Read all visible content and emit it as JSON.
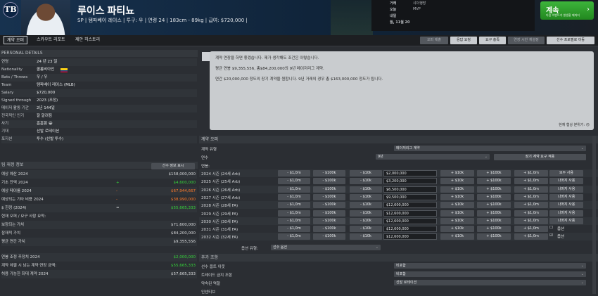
{
  "header": {
    "logo": "TB",
    "player_name": "루이스 파티뇨",
    "player_info": "SP | 탬파베이 레이스 | 투구: 우 | 연령 24 | 183cm - 89kg | 급여: $720,000 |",
    "roster": [
      {
        "k": "거래",
        "v": "샤이행방"
      },
      {
        "k": "오늘",
        "v": "MVP"
      },
      {
        "k": "내일",
        "v": ""
      },
      {
        "k": "월, 11월 20",
        "v": ""
      }
    ],
    "continue_label": "계속",
    "continue_sub": "다음 이벤트가 발생할 때까지",
    "continue_arrow": "›"
  },
  "tabs": [
    {
      "label": "계약 오퍼"
    },
    {
      "label": "스카우트 리포트"
    },
    {
      "label": "제안 히스토리"
    }
  ],
  "header_buttons": [
    {
      "label": "오퍼 제출"
    },
    {
      "label": "응답 요청"
    },
    {
      "label": "요구 충족"
    },
    {
      "label": "연장 시한 재설정"
    },
    {
      "label": "선수 프로필로 이동"
    }
  ],
  "personal": {
    "title": "PERSONAL DETAILS",
    "rows": [
      {
        "k": "연령",
        "v": "24 년 23 일"
      },
      {
        "k": "Nationality",
        "v": "콜롬비아인"
      },
      {
        "k": "Bats / Throws",
        "v": "우 / 우"
      },
      {
        "k": "Team",
        "v": "탬파베이 레이스 (MLB)"
      },
      {
        "k": "Salary",
        "v": "$720,000"
      },
      {
        "k": "Signed through",
        "v": "2023 (조정)"
      },
      {
        "k": "메이저 활동 기간",
        "v": "2년 144일"
      },
      {
        "k": "전국적인 인기",
        "v": "잘 알려짐"
      },
      {
        "k": "사기",
        "v": "흠흠함 😀"
      },
      {
        "k": "기대",
        "v": "선발 로테이션"
      },
      {
        "k": "포지션",
        "v": "투수 (선발 투수)"
      }
    ]
  },
  "team_finance": {
    "title": "팀 재정 정보",
    "button": "선수 정보 표시",
    "rows": [
      {
        "k": "예상 예산 2024",
        "op": "",
        "v": "$158,000,000",
        "c": ""
      },
      {
        "k": "기초 잔액 2024",
        "op": "+",
        "v": "$4,600,000",
        "c": "green"
      },
      {
        "k": "예상 페이롤 2024",
        "op": "-",
        "v": "$67,944,667",
        "c": "orange"
      },
      {
        "k": "예상되는 기타 비용 2024",
        "op": "-",
        "v": "$38,990,000",
        "c": "orange"
      },
      {
        "k": "$ 한정 (2024)",
        "op": "=",
        "v": "$55,665,333",
        "c": "green"
      }
    ]
  },
  "current_offer": {
    "title": "현재 오퍼 / 요구 사항 요약:",
    "rows": [
      {
        "k": "보장되는 가치",
        "v": "$71,600,000"
      },
      {
        "k": "잠재적 가치",
        "v": "$84,200,000"
      },
      {
        "k": "평균 연간 가치",
        "v": "$9,355,556"
      }
    ]
  },
  "payroll": {
    "rows": [
      {
        "k": "연봉 조정 추정치 2024",
        "v": "$2,000,000",
        "c": "green"
      },
      {
        "k": "계약 체결 시 남는 계약 연장 금액:",
        "v": "$55,665,333",
        "c": "green"
      },
      {
        "k": "허용 가능한 최대 계약 2024",
        "v": "$57,665,333",
        "c": ""
      }
    ]
  },
  "chat": {
    "lines": [
      "계약 연장을 하면 좋겠습니다. 제가 생각해도 조건은 이렇습니다.",
      "평균 연봉 $9,355,556, 총$84,200,000의 9년 메이저리그 계약.",
      "연간 $20,000,000 정도의 장기 계약을 원합니다. 9년 거래의 경우 총 $163,000,000 정도가 됩니다."
    ],
    "mood": "현재 협상 분위기:"
  },
  "contract": {
    "title": "계약 오퍼",
    "type_label": "계약 유형",
    "type_value": "메이저리그 계약",
    "years_label": "연수",
    "years_value": "9년",
    "long_term_btn": "장기 계약 요구 적용",
    "salary_label": "연봉:",
    "minus": [
      "- $1,0m",
      "- $100k",
      "- $10k"
    ],
    "plus": [
      "+ $10k",
      "+ $100k",
      "+ $1,0m"
    ],
    "seasons": [
      {
        "label": "2024 시즌 (24세 Arb)",
        "amount": "$2,000,000",
        "action": "모두 사용"
      },
      {
        "label": "2025 시즌 (25세 Arb)",
        "amount": "$3,200,000",
        "action": "나머지 사용"
      },
      {
        "label": "2026 시즌 (26세 Arb)",
        "amount": "$6,500,000",
        "action": "나머지 사용"
      },
      {
        "label": "2027 시즌 (27세 Arb)",
        "amount": "$9,500,000",
        "action": "나머지 사용"
      },
      {
        "label": "2028 시즌 (28세 FA)",
        "amount": "$12,600,000",
        "action": "나머지 사용"
      },
      {
        "label": "2029 시즌 (29세 FA)",
        "amount": "$12,600,000",
        "action": "나머지 사용"
      },
      {
        "label": "2030 시즌 (30세 FA)",
        "amount": "$12,600,000",
        "action": "나머지 사용"
      },
      {
        "label": "2031 시즌 (31세 FA)",
        "amount": "$12,600,000",
        "action": "옵션",
        "checkbox": "☐"
      },
      {
        "label": "2032 시즌 (32세 FA)",
        "amount": "$12,600,000",
        "action": "옵션",
        "checkbox": "☑"
      }
    ],
    "option_type_label": "옵션 유형:",
    "option_type_value": "선수 옵션",
    "extra_title": "추가 조항",
    "extras": [
      {
        "k": "선수 옵트 아웃",
        "v": "비포함"
      },
      {
        "k": "트레이드 금지 조항",
        "v": "비포함"
      },
      {
        "k": "약속된 역할",
        "v": "선발 로테이션"
      }
    ],
    "incentive_label": "인센티브"
  }
}
